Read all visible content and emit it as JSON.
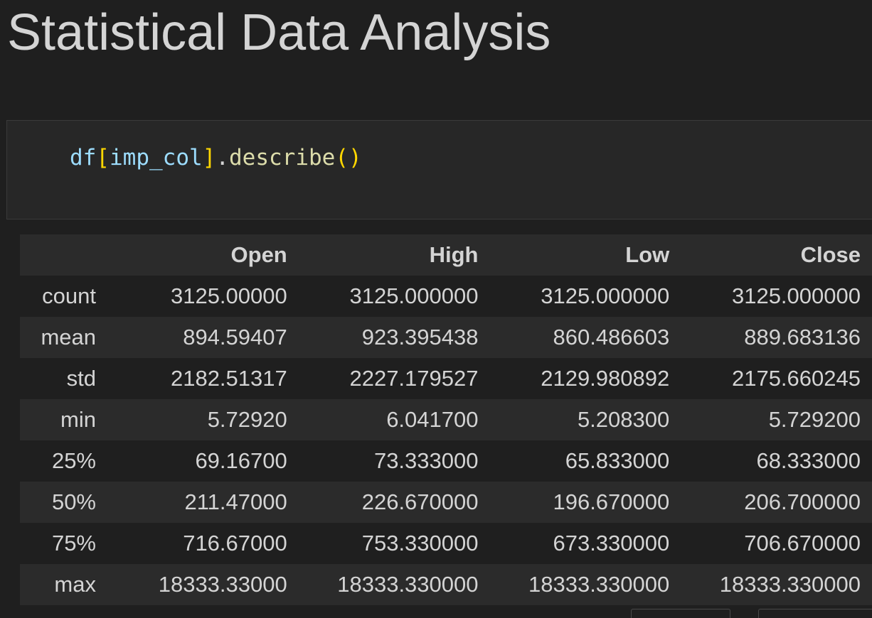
{
  "page": {
    "heading": "Statistical Data Analysis"
  },
  "code_cell": {
    "tokens": {
      "df": "df",
      "open_bracket": "[",
      "arg": "imp_col",
      "close_bracket": "]",
      "dot": ".",
      "method": "describe",
      "open_paren": "(",
      "close_paren": ")"
    }
  },
  "output_table": {
    "columns": [
      "",
      "Open",
      "High",
      "Low",
      "Close"
    ],
    "rows": [
      {
        "label": "count",
        "values": [
          "3125.00000",
          "3125.000000",
          "3125.000000",
          "3125.000000"
        ]
      },
      {
        "label": "mean",
        "values": [
          "894.59407",
          "923.395438",
          "860.486603",
          "889.683136"
        ]
      },
      {
        "label": "std",
        "values": [
          "2182.51317",
          "2227.179527",
          "2129.980892",
          "2175.660245"
        ]
      },
      {
        "label": "min",
        "values": [
          "5.72920",
          "6.041700",
          "5.208300",
          "5.729200"
        ]
      },
      {
        "label": "25%",
        "values": [
          "69.16700",
          "73.333000",
          "65.833000",
          "68.333000"
        ]
      },
      {
        "label": "50%",
        "values": [
          "211.47000",
          "226.670000",
          "196.670000",
          "206.700000"
        ]
      },
      {
        "label": "75%",
        "values": [
          "716.67000",
          "753.330000",
          "673.330000",
          "706.670000"
        ]
      },
      {
        "label": "max",
        "values": [
          "18333.33000",
          "18333.330000",
          "18333.330000",
          "18333.330000"
        ]
      }
    ]
  },
  "colors": {
    "background": "#1f1f1f",
    "code_cell_background": "#272727",
    "variable": "#9cdcfe",
    "bracket": "#ffd700",
    "function": "#dcdcaa",
    "table_stripe": "#2b2b2b"
  }
}
